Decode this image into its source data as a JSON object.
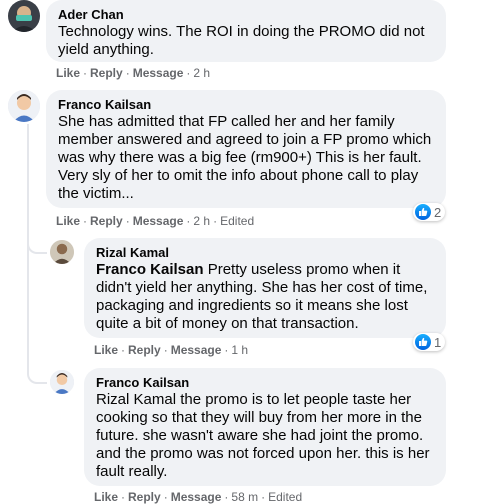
{
  "comments": [
    {
      "author": "Ader Chan",
      "text": "Technology wins. The ROI in doing the PROMO did not yield anything.",
      "actions": {
        "like": "Like",
        "reply": "Reply",
        "message": "Message",
        "time": "2 h"
      }
    },
    {
      "author": "Franco Kailsan",
      "text": "She has admitted that FP called her and her family member answered and agreed to join a FP promo which was why there was a big fee (rm900+) This is her fault. Very sly of her to omit the info about phone call to play the victim...",
      "actions": {
        "like": "Like",
        "reply": "Reply",
        "message": "Message",
        "time": "2 h",
        "edited": "Edited"
      },
      "reaction_count": "2"
    },
    {
      "author": "Rizal Kamal",
      "mention": "Franco Kailsan",
      "text": " Pretty useless promo when it didn't yield her anything. She has her cost of time, packaging and ingredients so it means she lost quite a bit of money on that transaction.",
      "actions": {
        "like": "Like",
        "reply": "Reply",
        "message": "Message",
        "time": "1 h"
      },
      "reaction_count": "1"
    },
    {
      "author": "Franco Kailsan",
      "text": "Rizal Kamal the promo is to let people taste her cooking so that they will buy from her more in the future. she wasn't aware she had joint the promo. and the promo was not forced upon her. this is her fault really.",
      "actions": {
        "like": "Like",
        "reply": "Reply",
        "message": "Message",
        "time": "58 m",
        "edited": "Edited"
      }
    }
  ],
  "colors": {
    "bubble": "#f0f2f5",
    "meta": "#65676b",
    "like_blue": "#0866ff"
  }
}
